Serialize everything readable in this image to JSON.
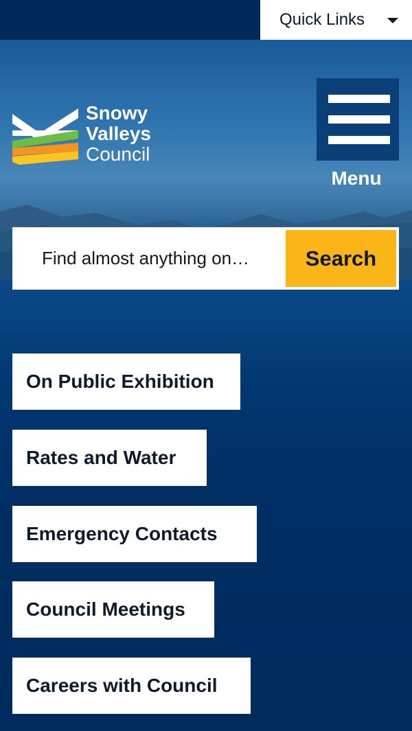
{
  "header": {
    "quick_links_label": "Quick Links"
  },
  "logo": {
    "line1": "Snowy",
    "line2": "Valleys",
    "line3": "Council"
  },
  "menu": {
    "label": "Menu"
  },
  "search": {
    "placeholder": "Find almost anything on…",
    "button_label": "Search"
  },
  "quick_buttons": [
    {
      "label": "On Public Exhibition"
    },
    {
      "label": "Rates and Water"
    },
    {
      "label": "Emergency Contacts"
    },
    {
      "label": "Council Meetings"
    },
    {
      "label": "Careers with Council"
    }
  ],
  "colors": {
    "navy": "#012a5b",
    "accent_yellow": "#fbb517",
    "logo_green": "#6cbe45",
    "logo_orange": "#f7941d",
    "logo_yellow": "#fcc620"
  }
}
